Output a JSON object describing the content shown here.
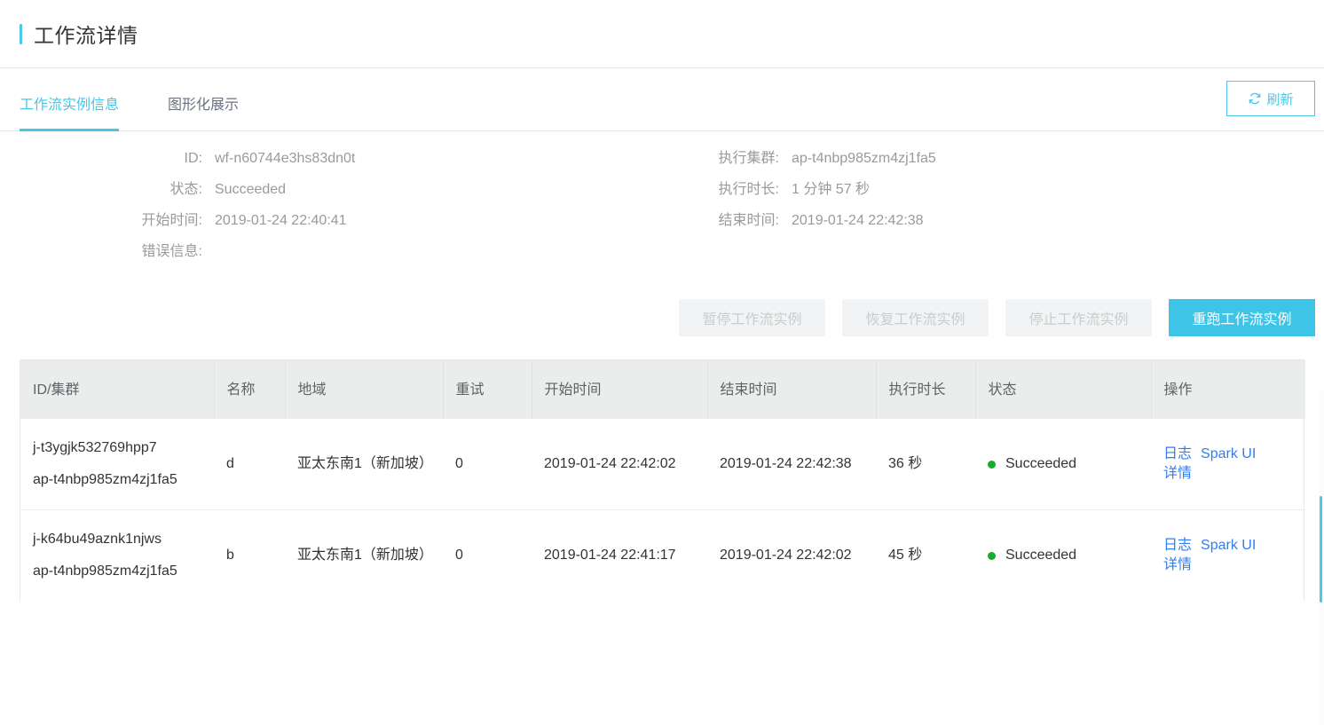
{
  "header": {
    "title": "工作流详情",
    "accent_color": "#4cc8e8"
  },
  "tabs": [
    {
      "label": "工作流实例信息",
      "active": true
    },
    {
      "label": "图形化展示",
      "active": false
    }
  ],
  "refresh": {
    "label": "刷新",
    "icon": "refresh-icon",
    "color": "#4cc8e8"
  },
  "info": {
    "left": [
      {
        "label": "ID:",
        "value": "wf-n60744e3hs83dn0t"
      },
      {
        "label": "状态:",
        "value": "Succeeded"
      },
      {
        "label": "开始时间:",
        "value": "2019-01-24 22:40:41"
      },
      {
        "label": "错误信息:",
        "value": ""
      }
    ],
    "right": [
      {
        "label": "执行集群:",
        "value": "ap-t4nbp985zm4zj1fa5"
      },
      {
        "label": "执行时长:",
        "value": "1 分钟 57 秒"
      },
      {
        "label": "结束时间:",
        "value": "2019-01-24 22:42:38"
      }
    ]
  },
  "actions": [
    {
      "label": "暂停工作流实例",
      "disabled": true
    },
    {
      "label": "恢复工作流实例",
      "disabled": true
    },
    {
      "label": "停止工作流实例",
      "disabled": true
    },
    {
      "label": "重跑工作流实例",
      "disabled": false,
      "color": "#3ec4e7"
    }
  ],
  "table": {
    "columns": [
      "ID/集群",
      "名称",
      "地域",
      "重试",
      "开始时间",
      "结束时间",
      "执行时长",
      "状态",
      "操作"
    ],
    "rows": [
      {
        "job_id": "j-t3ygjk532769hpp7",
        "cluster_id": "ap-t4nbp985zm4zj1fa5",
        "name": "d",
        "region": "亚太东南1（新加坡）",
        "retry": "0",
        "start_time": "2019-01-24 22:42:02",
        "end_time": "2019-01-24 22:42:38",
        "duration": "36 秒",
        "status": "Succeeded",
        "status_color": "#17ab2b",
        "ops": [
          "日志",
          "Spark UI",
          "详情"
        ]
      },
      {
        "job_id": "j-k64bu49aznk1njws",
        "cluster_id": "ap-t4nbp985zm4zj1fa5",
        "name": "b",
        "region": "亚太东南1（新加坡）",
        "retry": "0",
        "start_time": "2019-01-24 22:41:17",
        "end_time": "2019-01-24 22:42:02",
        "duration": "45 秒",
        "status": "Succeeded",
        "status_color": "#17ab2b",
        "ops": [
          "日志",
          "Spark UI",
          "详情"
        ]
      }
    ]
  }
}
